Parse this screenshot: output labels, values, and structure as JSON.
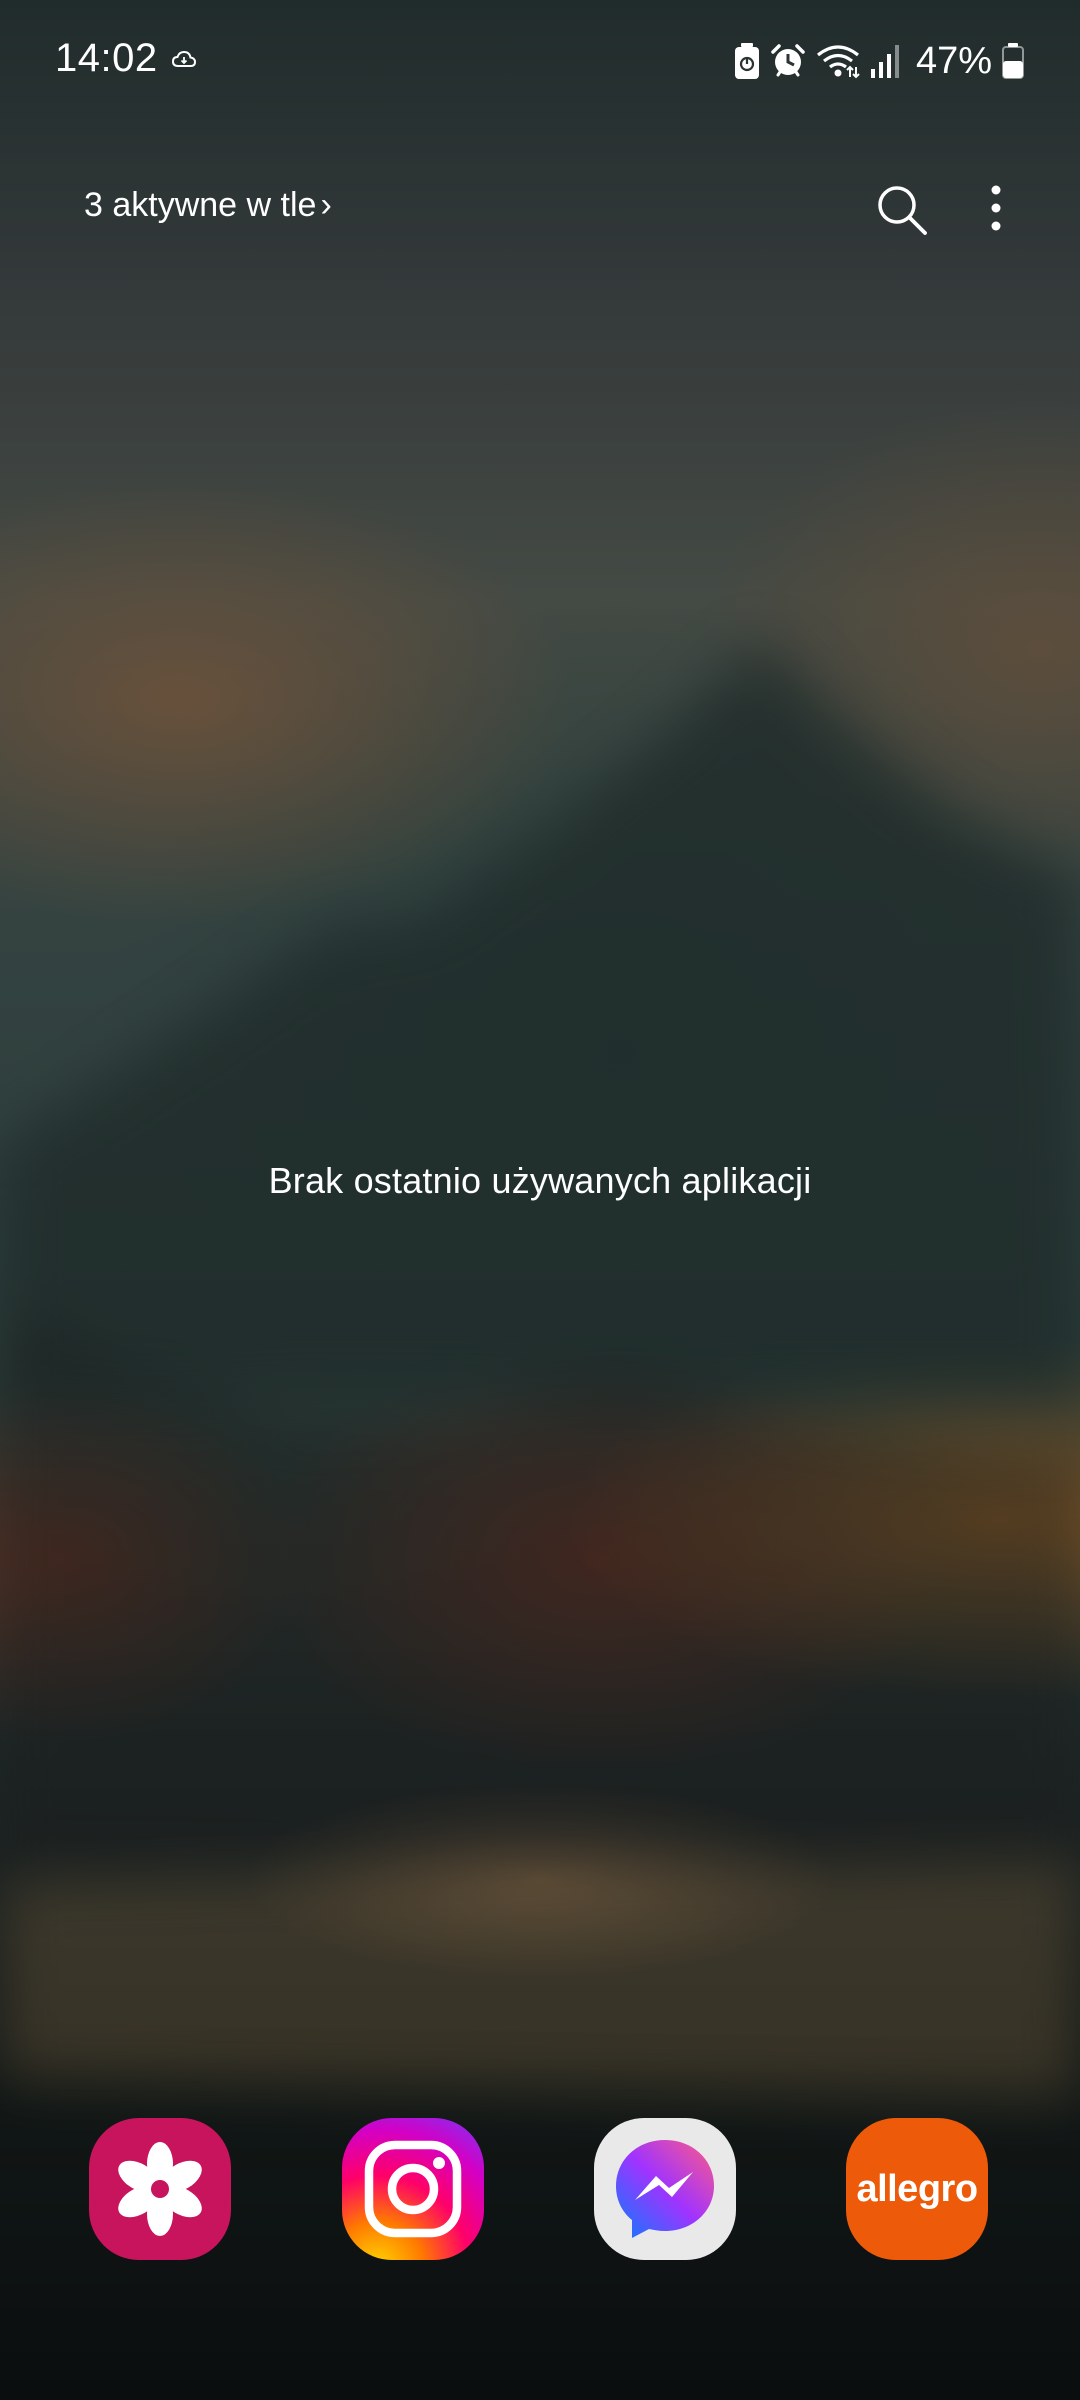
{
  "status_bar": {
    "time": "14:02",
    "battery_percent": "47%",
    "icons": [
      "cloud-icon",
      "battery-saver-icon",
      "alarm-icon",
      "wifi-icon",
      "signal-icon",
      "battery-icon"
    ]
  },
  "top_bar": {
    "background_apps_label": "3 aktywne w tle",
    "chevron": "›",
    "icons": [
      "search-icon",
      "more-options-icon"
    ]
  },
  "main": {
    "empty_message": "Brak ostatnio używanych aplikacji"
  },
  "dock": {
    "apps": [
      {
        "icon": "gallery-icon",
        "color": "#c8145c"
      },
      {
        "icon": "instagram-icon",
        "color": "#e1306c"
      },
      {
        "icon": "messenger-icon",
        "color": "#e9e9e9"
      },
      {
        "icon": "allegro-icon",
        "label": "allegro",
        "color": "#ec5a0a"
      }
    ]
  }
}
